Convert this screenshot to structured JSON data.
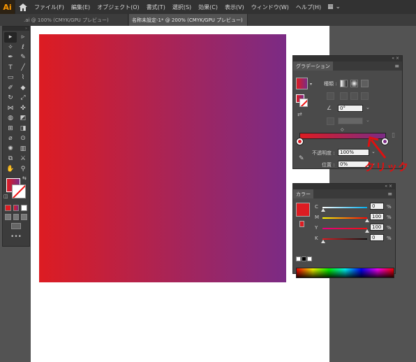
{
  "app": {
    "logo": "Ai"
  },
  "menu": [
    "ファイル(F)",
    "編集(E)",
    "オブジェクト(O)",
    "書式(T)",
    "選択(S)",
    "効果(C)",
    "表示(V)",
    "ウィンドウ(W)",
    "ヘルプ(H)"
  ],
  "tabs": [
    {
      "label": ".ai @ 100% (CMYK/GPU プレビュー)",
      "active": false
    },
    {
      "label": "名称未設定-1* @ 200% (CMYK/GPU プレビュー)",
      "active": true,
      "close": "×"
    }
  ],
  "gradient_panel": {
    "tab": "グラデーション",
    "type_label": "種類 :",
    "angle_value": "0°",
    "opacity_label": "不透明度 :",
    "opacity_value": "100%",
    "location_label": "位置 :",
    "location_value": "0%",
    "start_color": "#dd1c22",
    "end_color": "#7b2b85"
  },
  "color_panel": {
    "tab": "カラー",
    "fill_color": "#dd1c22",
    "channels": [
      {
        "label": "C",
        "value": "0",
        "unit": "%"
      },
      {
        "label": "M",
        "value": "100",
        "unit": "%"
      },
      {
        "label": "Y",
        "value": "100",
        "unit": "%"
      },
      {
        "label": "K",
        "value": "0",
        "unit": "%"
      }
    ]
  },
  "annotation": {
    "text": "クリック",
    "color": "#e01010"
  },
  "icons": {
    "home": "home-icon",
    "workspace": "workspace-switcher-icon",
    "panel_menu": "panel-menu-icon",
    "eyedropper": "eyedropper-icon"
  }
}
